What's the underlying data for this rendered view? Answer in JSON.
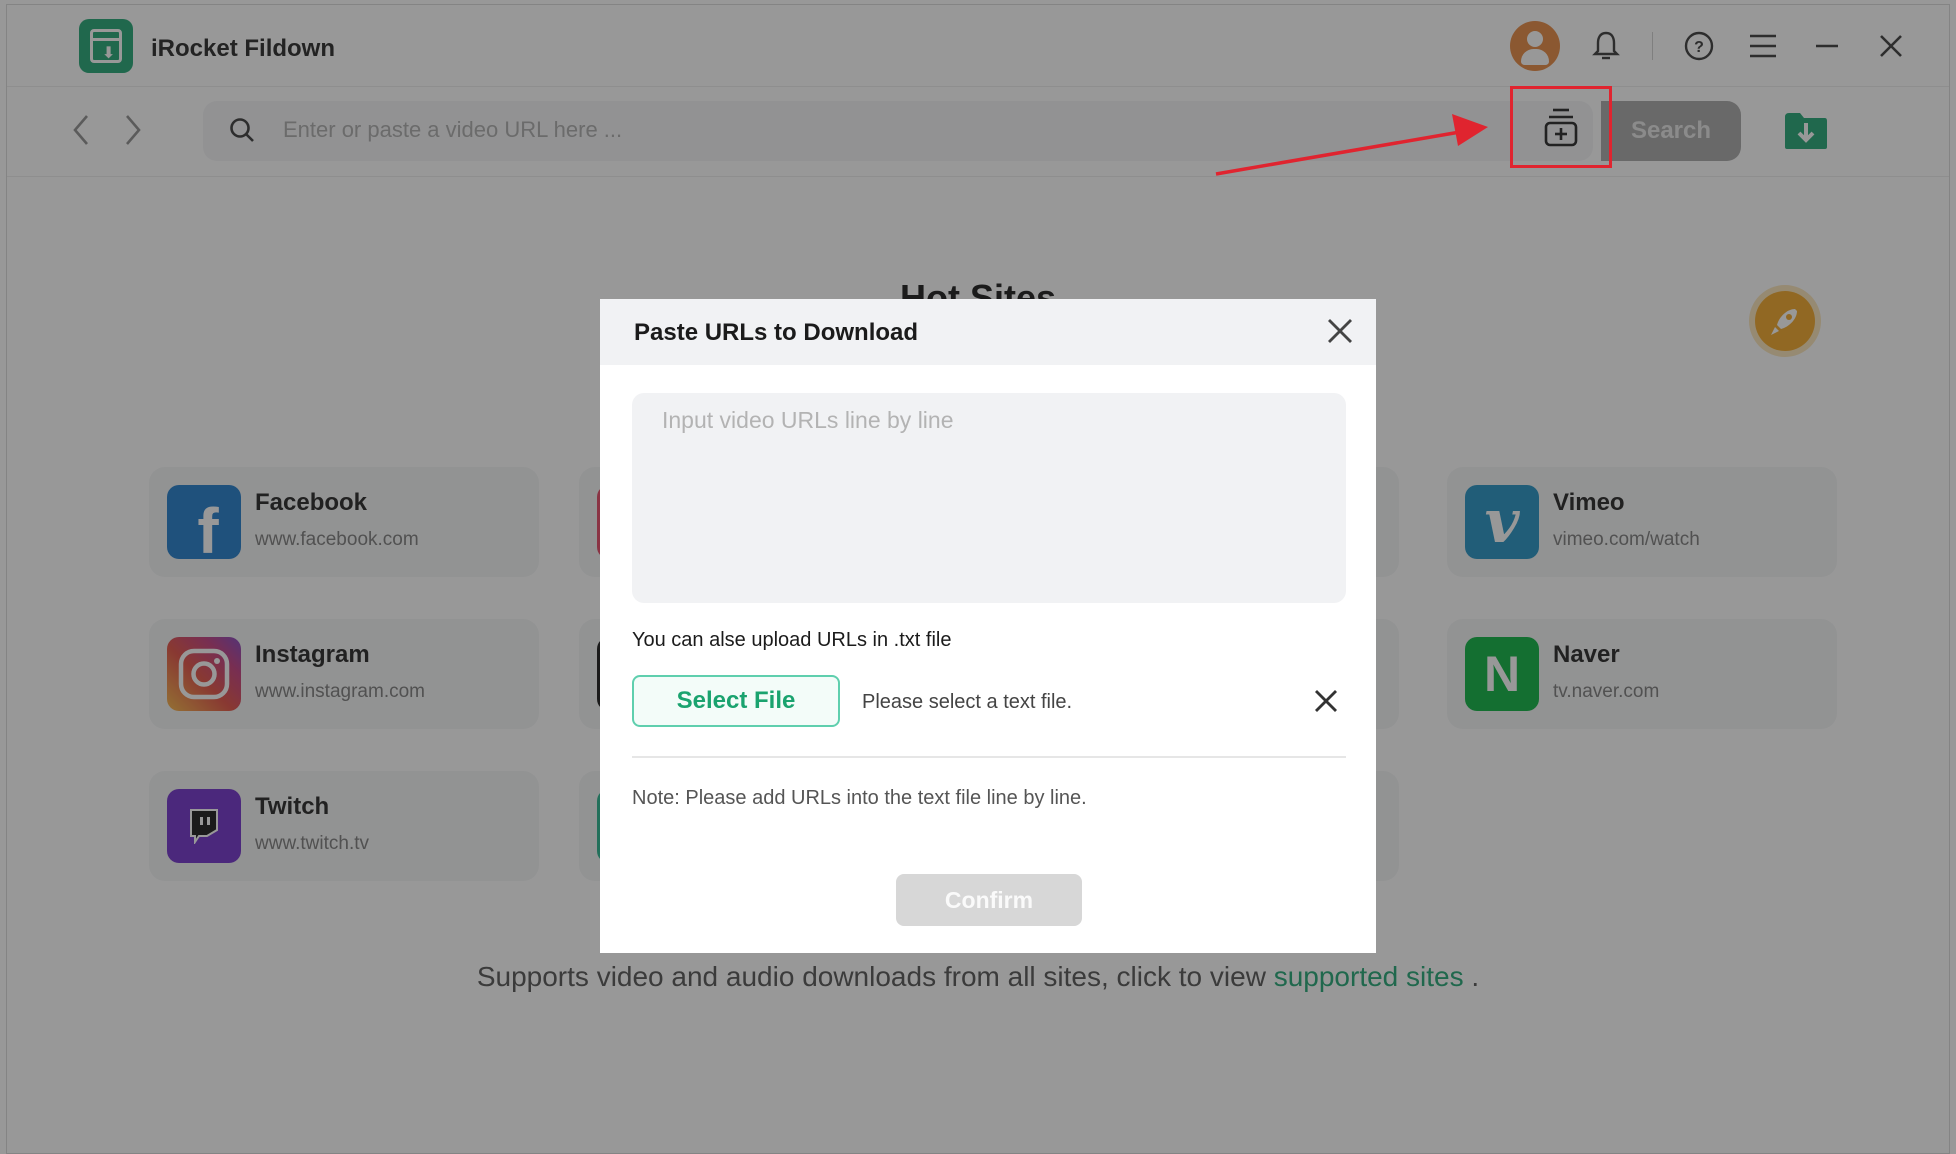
{
  "app": {
    "title": "iRocket Fildown",
    "brand_color": "#1aa36f"
  },
  "titlebar": {
    "icons": [
      "avatar-icon",
      "bell-icon",
      "help-icon",
      "menu-icon",
      "minimize-icon",
      "close-icon"
    ],
    "help_glyph": "?",
    "menu_glyph": "☰",
    "minimize_glyph": "—",
    "close_glyph": "✕"
  },
  "toolbar": {
    "back_glyph": "‹",
    "forward_glyph": "›",
    "search_placeholder": "Enter or paste a video URL here ...",
    "search_button": "Search",
    "batch_button_icon": "batch-add-icon",
    "downloads_icon": "download-folder-icon"
  },
  "main": {
    "hot_sites_title": "Hot Sites",
    "sites": [
      {
        "name": "Facebook",
        "url": "www.facebook.com",
        "icon": "facebook-icon",
        "color": "#1877c9"
      },
      {
        "name": "Instagram",
        "url": "www.instagram.com",
        "icon": "instagram-icon",
        "color": "#c1357a"
      },
      {
        "name": "Twitch",
        "url": "www.twitch.tv",
        "icon": "twitch-icon",
        "color": "#6c2ac9"
      },
      {
        "name": "Vimeo",
        "url": "vimeo.com/watch",
        "icon": "vimeo-icon",
        "color": "#1b8fc1"
      },
      {
        "name": "Naver",
        "url": "tv.naver.com",
        "icon": "naver-icon",
        "color": "#03b13b"
      }
    ],
    "footer_text": "Supports video and audio downloads from all sites, click to view ",
    "footer_link": "supported sites",
    "footer_end": " ."
  },
  "modal": {
    "title": "Paste URLs to Download",
    "close_glyph": "✕",
    "textarea_placeholder": "Input video URLs line by line",
    "textarea_value": "",
    "upload_label": "You can alse upload URLs in .txt file",
    "select_file_button": "Select File",
    "file_status": "Please select a text file.",
    "clear_glyph": "✕",
    "note": "Note: Please add URLs into the text file line by line.",
    "confirm_button": "Confirm",
    "confirm_enabled": false
  },
  "annotation": {
    "highlight_color": "#e0242f",
    "target": "batch-add-button"
  }
}
